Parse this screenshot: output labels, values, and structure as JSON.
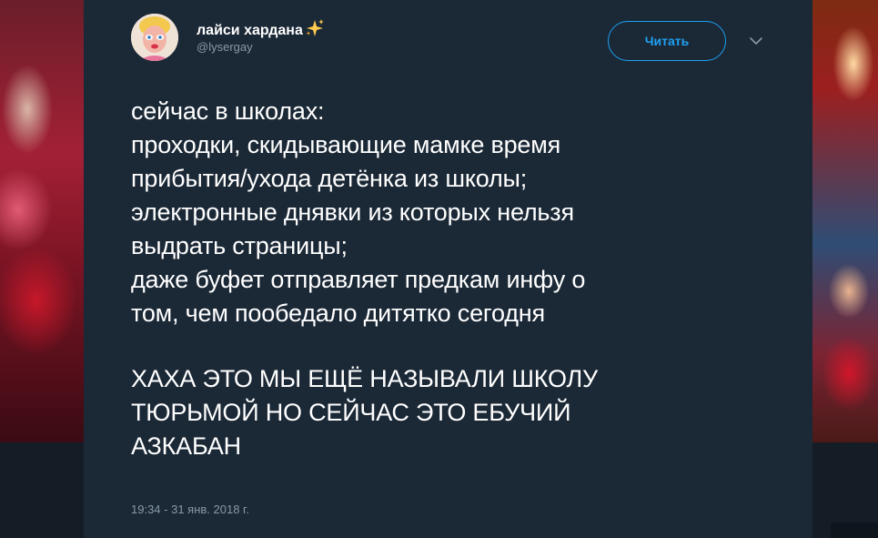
{
  "tweet": {
    "user_name": "лайси хардана",
    "user_name_emoji": "sparkles-icon",
    "handle": "@lysergay",
    "follow_label": "Читать",
    "lines": [
      "сейчас в школах:",
      "проходки, скидывающие мамке время",
      "прибытия/ухода детёнка из школы;",
      "электронные днявки из которых нельзя",
      "выдрать страницы;",
      "даже буфет отправляет предкам инфу о",
      "том, чем пообедало дитятко сегодня"
    ],
    "caps_lines": [
      "ХАХА ЭТО МЫ ЕЩЁ НАЗЫВАЛИ ШКОЛУ",
      "ТЮРЬМОЙ НО СЕЙЧАС ЭТО ЕБУЧИЙ",
      "АЗКАБАН"
    ],
    "timestamp": "19:34 - 31 янв. 2018 г."
  },
  "colors": {
    "card_background": "#1b2836",
    "page_background": "#141d26",
    "accent": "#1da1f2",
    "text_primary": "#ffffff",
    "text_secondary": "#8899a6"
  }
}
